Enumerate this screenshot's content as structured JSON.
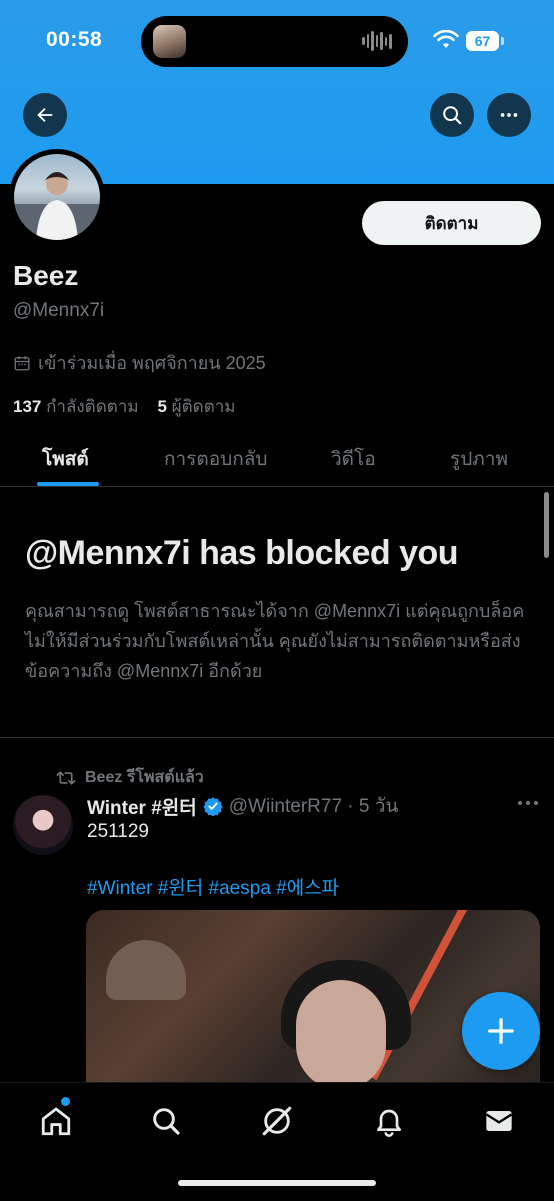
{
  "status_bar": {
    "time": "00:58",
    "battery": "67"
  },
  "profile": {
    "name": "Beez",
    "handle": "@Mennx7i",
    "joined": "เข้าร่วมเมื่อ พฤศจิกายน 2025",
    "following_count": "137",
    "following_label": "กำลังติดตาม",
    "followers_count": "5",
    "followers_label": "ผู้ติดตาม",
    "follow_button": "ติดตาม"
  },
  "tabs": [
    {
      "label": "โพสต์",
      "active": true
    },
    {
      "label": "การตอบกลับ",
      "active": false
    },
    {
      "label": "วิดีโอ",
      "active": false
    },
    {
      "label": "รูปภาพ",
      "active": false
    }
  ],
  "blocked": {
    "title": "@Mennx7i has blocked you",
    "description": "คุณสามารถดู โพสต์สาธารณะได้จาก @Mennx7i แต่คุณถูกบล็อคไม่ให้มีส่วนร่วมกับโพสต์เหล่านั้น คุณยังไม่สามารถติดตามหรือส่งข้อความถึง @Mennx7i อีกด้วย"
  },
  "tweet": {
    "repost_label": "Beez รีโพสต์แล้ว",
    "author": "Winter #윈터",
    "handle_time": "@WiinterR77 · 5 วัน",
    "text": "251129",
    "hashtags": "#Winter #윈터 #aespa #에스파"
  },
  "colors": {
    "accent": "#1d9bf0",
    "background": "#000000",
    "secondary_text": "#71767b"
  },
  "icons": [
    "back-arrow-icon",
    "search-icon",
    "more-icon",
    "calendar-icon",
    "repost-icon",
    "verified-icon",
    "plus-icon",
    "home-icon",
    "explore-icon",
    "grok-icon",
    "notifications-icon",
    "messages-icon"
  ]
}
